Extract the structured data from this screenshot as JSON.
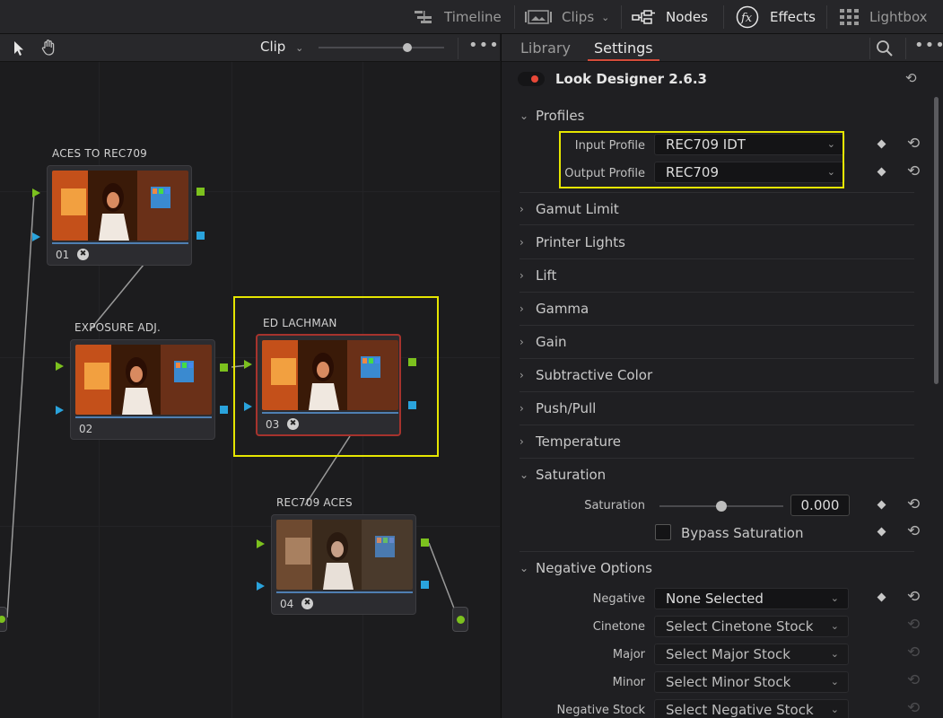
{
  "topbar": {
    "timeline": "Timeline",
    "clips": "Clips",
    "nodes": "Nodes",
    "effects": "Effects",
    "lightbox": "Lightbox"
  },
  "node_editor": {
    "mode": "Clip",
    "zoom_fraction": 0.72,
    "nodes": [
      {
        "label": "ACES TO REC709",
        "num": "01"
      },
      {
        "label": "EXPOSURE ADJ.",
        "num": "02"
      },
      {
        "label": "ED LACHMAN",
        "num": "03"
      },
      {
        "label": "REC709 ACES",
        "num": "04"
      }
    ]
  },
  "inspector": {
    "tabs": [
      "Library",
      "Settings"
    ],
    "active_tab": "Settings",
    "plugin_title": "Look Designer 2.6.3",
    "profiles": {
      "title": "Profiles",
      "input_label": "Input Profile",
      "input_value": "REC709 IDT",
      "output_label": "Output Profile",
      "output_value": "REC709"
    },
    "collapsed_sections": [
      "Gamut Limit",
      "Printer Lights",
      "Lift",
      "Gamma",
      "Gain",
      "Subtractive Color",
      "Push/Pull",
      "Temperature"
    ],
    "saturation": {
      "title": "Saturation",
      "label": "Saturation",
      "value": "0.000",
      "slider_fraction": 0.5,
      "bypass_label": "Bypass Saturation"
    },
    "negative_options": {
      "title": "Negative Options",
      "rows": [
        {
          "label": "Negative",
          "value": "None Selected"
        },
        {
          "label": "Cinetone",
          "value": "Select Cinetone Stock"
        },
        {
          "label": "Major",
          "value": "Select Major Stock"
        },
        {
          "label": "Minor",
          "value": "Select Minor Stock"
        },
        {
          "label": "Negative Stock",
          "value": "Select Negative Stock"
        }
      ]
    }
  },
  "colors": {
    "accent_red": "#d44b3a",
    "highlight_yellow": "#e6e600",
    "port_green": "#7cc11e",
    "port_blue": "#2aa3dc"
  }
}
